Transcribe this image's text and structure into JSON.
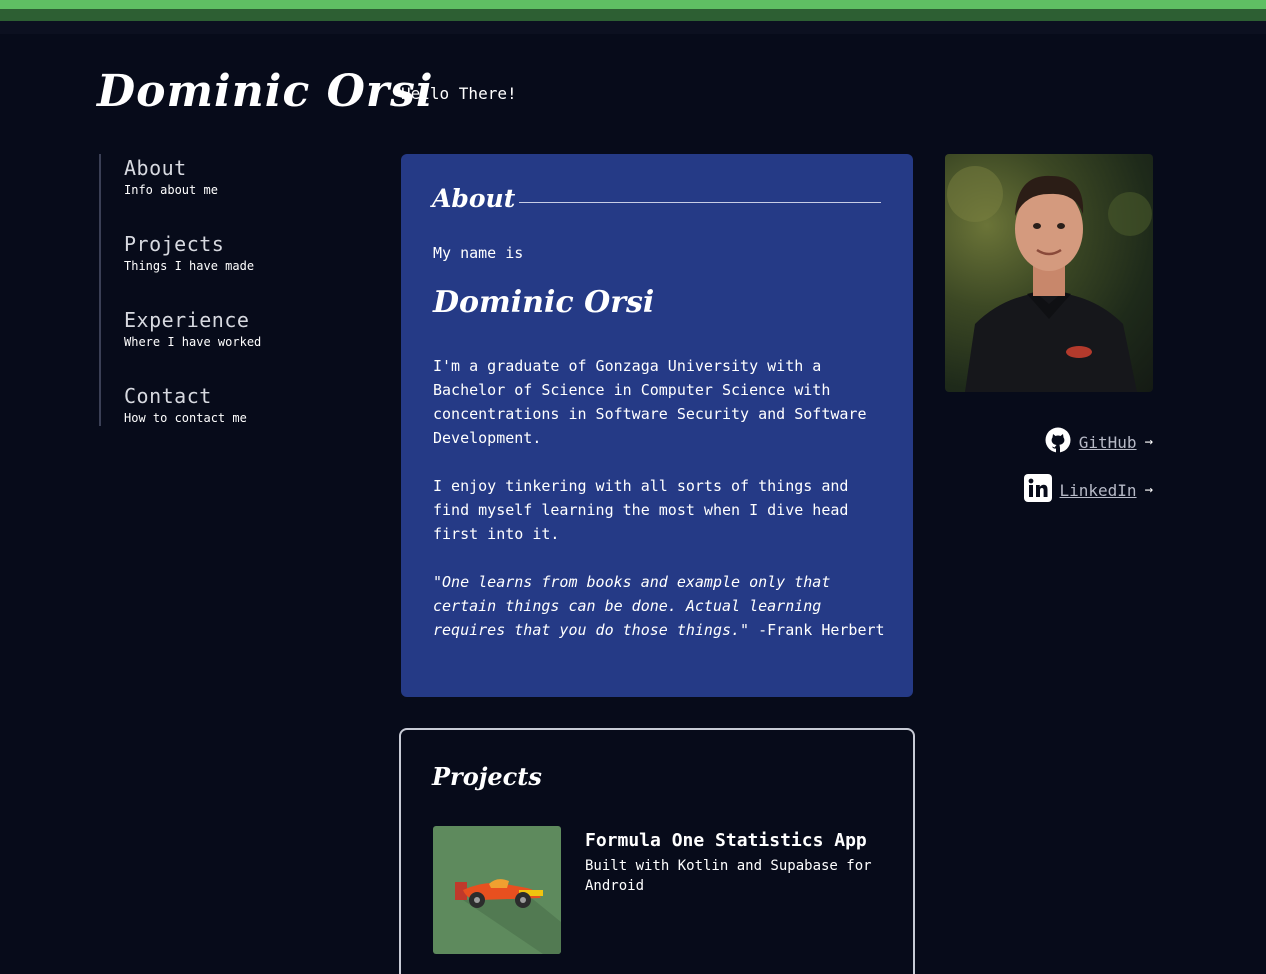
{
  "header": {
    "title": "Dominic Orsi",
    "tagline": "Hello There!"
  },
  "sidebar": {
    "items": [
      {
        "title": "About",
        "subtitle": "Info about me"
      },
      {
        "title": "Projects",
        "subtitle": "Things I have made"
      },
      {
        "title": "Experience",
        "subtitle": "Where I have worked"
      },
      {
        "title": "Contact",
        "subtitle": "How to contact me"
      }
    ]
  },
  "about": {
    "heading": "About",
    "intro": "My name is",
    "name": "Dominic Orsi",
    "paragraph1": "I'm a graduate of Gonzaga University with a Bachelor of Science in Computer Science with concentrations in Software Security and Software Development.",
    "paragraph2": "I enjoy tinkering with all sorts of things and find myself learning the most when I dive head first into it.",
    "quote": "\"One learns from books and example only that certain things can be done. Actual learning requires that you do those things.\"",
    "quote_author": " -Frank Herbert"
  },
  "social": {
    "github_label": "GitHub",
    "linkedin_label": "LinkedIn",
    "arrow": "→"
  },
  "projects": {
    "heading": "Projects",
    "items": [
      {
        "title": "Formula One Statistics App",
        "description": "Built with Kotlin and Supabase for Android"
      }
    ]
  },
  "colors": {
    "background": "#070b1a",
    "accent_green": "#5fbf63",
    "about_card": "#253a86",
    "project_thumb": "#5e8a5d"
  },
  "icons": {
    "github": "github-icon",
    "linkedin": "linkedin-icon",
    "project": "race-car-icon"
  }
}
